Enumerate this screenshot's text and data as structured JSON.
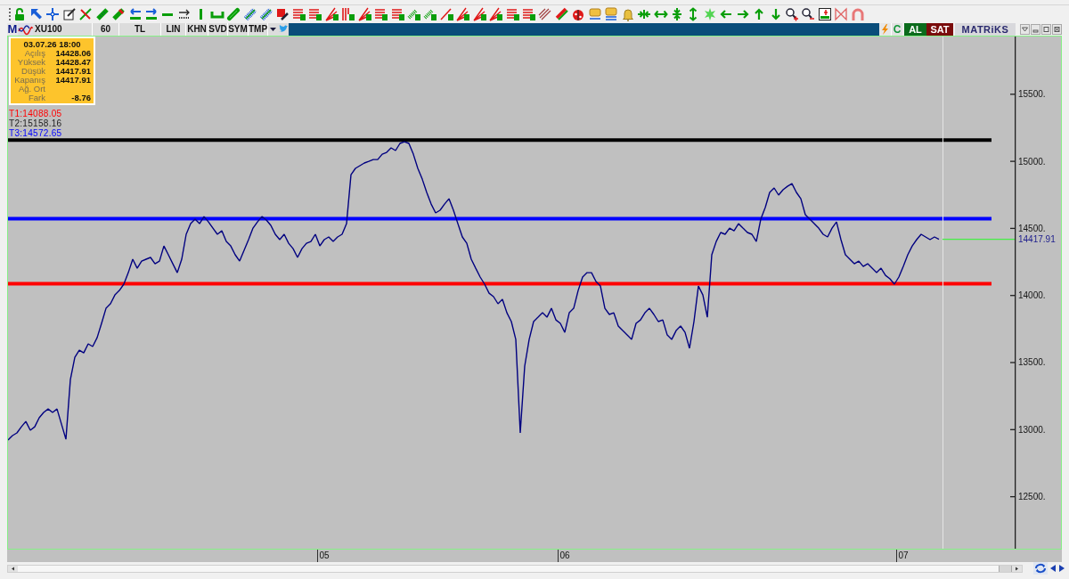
{
  "symbol_bar": {
    "menu": "M",
    "symbol": "XU100",
    "period": "60",
    "currency": "TL",
    "buttons": [
      {
        "label": "LIN"
      },
      {
        "label": "KHN"
      },
      {
        "label": "SVD"
      },
      {
        "label": "SYM"
      },
      {
        "label": "TMP"
      }
    ]
  },
  "trade_bar": {
    "refresh": "C",
    "buy": "AL",
    "sell": "SAT",
    "brand": "MATRiKS"
  },
  "info_box": {
    "date": "03.07.26 18:00",
    "rows": [
      {
        "label": "Açılış",
        "value": "14428.06"
      },
      {
        "label": "Yüksek",
        "value": "14428.47"
      },
      {
        "label": "Düşük",
        "value": "14417.91"
      },
      {
        "label": "Kapanış",
        "value": "14417.91"
      },
      {
        "label": "Ağ. Ort"
      },
      {
        "label": "Fark",
        "value": "-8.76"
      }
    ]
  },
  "targets": [
    {
      "label": "T1:14088.05",
      "color": "#ff0000"
    },
    {
      "label": "T2:15158.16",
      "color": "#202020"
    },
    {
      "label": "T3:14572.65",
      "color": "#0000ff"
    }
  ],
  "chart": {
    "chart_data": {
      "type": "line",
      "ylim": [
        12112,
        15930
      ],
      "categories": [
        null,
        null,
        null,
        null,
        null,
        null,
        null,
        null,
        null,
        null,
        null,
        null,
        null,
        null,
        null,
        null,
        null,
        null,
        null,
        null,
        null,
        null,
        null,
        null,
        null,
        null,
        null,
        null,
        null,
        null,
        null,
        null,
        null,
        null,
        null,
        null,
        null,
        null,
        null,
        null,
        null,
        null,
        null,
        null,
        null,
        null,
        null,
        null,
        null,
        null,
        null,
        null,
        null,
        null,
        null,
        null,
        null,
        null,
        null,
        null,
        null,
        null,
        null,
        null,
        null,
        null,
        null,
        null,
        null,
        null,
        null,
        "05",
        null,
        null,
        null,
        null,
        null,
        null,
        null,
        null,
        null,
        null,
        null,
        null,
        null,
        null,
        null,
        null,
        null,
        null,
        null,
        null,
        null,
        null,
        null,
        null,
        null,
        null,
        null,
        null,
        null,
        null,
        null,
        null,
        null,
        null,
        null,
        null,
        null,
        null,
        null,
        null,
        null,
        null,
        null,
        null,
        null,
        null,
        null,
        null,
        null,
        null,
        null,
        null,
        null,
        "06",
        null,
        null,
        null,
        null,
        null,
        null,
        null,
        null,
        null,
        null,
        null,
        null,
        null,
        null,
        null,
        null,
        null,
        null,
        null,
        null,
        null,
        null,
        null,
        null,
        null,
        null,
        null,
        null,
        null,
        null,
        null,
        null,
        null,
        null,
        null,
        null,
        null,
        null,
        null,
        null,
        null,
        null,
        null,
        null,
        null,
        null,
        null,
        null,
        null,
        null,
        null,
        null,
        null,
        null,
        null,
        null,
        null,
        null,
        null,
        null,
        null,
        null,
        null,
        null,
        null,
        null,
        null,
        null,
        null,
        null,
        null,
        null,
        null,
        null,
        null,
        "07",
        null,
        null,
        null,
        null,
        null,
        null,
        null,
        null,
        null,
        null,
        null,
        null,
        null,
        null,
        null,
        null,
        null,
        null,
        null,
        null,
        null,
        null,
        null,
        null
      ],
      "yticks": [
        {
          "value": 12500,
          "label": "12500."
        },
        {
          "value": 13000,
          "label": "13000."
        },
        {
          "value": 13500,
          "label": "13500."
        },
        {
          "value": 14000,
          "label": "14000."
        },
        {
          "value": 14500,
          "label": "14500."
        },
        {
          "value": 15000,
          "label": "15000."
        },
        {
          "value": 15500,
          "label": "15500."
        }
      ],
      "series": [
        {
          "color": "#000080",
          "values": [
            12922,
            12955,
            12975,
            13021,
            13061,
            12995,
            13021,
            13088,
            13128,
            13154,
            13128,
            13154,
            13041,
            12928,
            13373,
            13539,
            13592,
            13572,
            13639,
            13619,
            13685,
            13792,
            13904,
            13938,
            14004,
            14037,
            14084,
            14170,
            14270,
            14203,
            14256,
            14270,
            14283,
            14236,
            14256,
            14369,
            14303,
            14236,
            14170,
            14270,
            14456,
            14535,
            14568,
            14535,
            14588,
            14548,
            14502,
            14456,
            14482,
            14402,
            14369,
            14303,
            14256,
            14336,
            14416,
            14502,
            14548,
            14588,
            14562,
            14522,
            14456,
            14416,
            14456,
            14389,
            14349,
            14283,
            14349,
            14389,
            14402,
            14456,
            14369,
            14416,
            14436,
            14402,
            14436,
            14456,
            14535,
            14900,
            14947,
            14967,
            14987,
            15000,
            15013,
            15013,
            15053,
            15066,
            15100,
            15080,
            15133,
            15146,
            15133,
            15053,
            14947,
            14867,
            14768,
            14681,
            14615,
            14635,
            14681,
            14721,
            14635,
            14535,
            14436,
            14389,
            14270,
            14203,
            14137,
            14084,
            14017,
            13991,
            13938,
            13971,
            13871,
            13805,
            13672,
            12975,
            13473,
            13672,
            13805,
            13838,
            13871,
            13838,
            13904,
            13818,
            13792,
            13725,
            13871,
            13904,
            14037,
            14137,
            14170,
            14170,
            14104,
            14070,
            13904,
            13858,
            13871,
            13772,
            13738,
            13705,
            13672,
            13792,
            13818,
            13871,
            13904,
            13858,
            13805,
            13818,
            13705,
            13672,
            13738,
            13772,
            13725,
            13606,
            13805,
            14070,
            14004,
            13838,
            14303,
            14402,
            14469,
            14456,
            14502,
            14482,
            14535,
            14502,
            14469,
            14456,
            14402,
            14568,
            14655,
            14768,
            14801,
            14748,
            14788,
            14814,
            14834,
            14768,
            14721,
            14602,
            14568,
            14535,
            14502,
            14456,
            14436,
            14502,
            14548,
            14416,
            14303,
            14270,
            14236,
            14256,
            14216,
            14236,
            14203,
            14170,
            14203,
            14150,
            14124,
            14084,
            14137,
            14216,
            14303,
            14369,
            14416,
            14456,
            14436,
            14416,
            14436,
            14418,
            null,
            null,
            null,
            null,
            null,
            null,
            null,
            null,
            null,
            null,
            null,
            null,
            null,
            null,
            null,
            null
          ]
        }
      ],
      "ref_lines": [
        {
          "axis": "y",
          "value": 14088.05,
          "color": "#ff0000"
        },
        {
          "axis": "y",
          "value": 15158.16,
          "color": "#000000"
        },
        {
          "axis": "y",
          "value": 14572.65,
          "color": "#0000ff"
        },
        {
          "axis": "y",
          "value": 14417.91,
          "color": "#44ee44",
          "label": "14417.91"
        }
      ]
    }
  }
}
